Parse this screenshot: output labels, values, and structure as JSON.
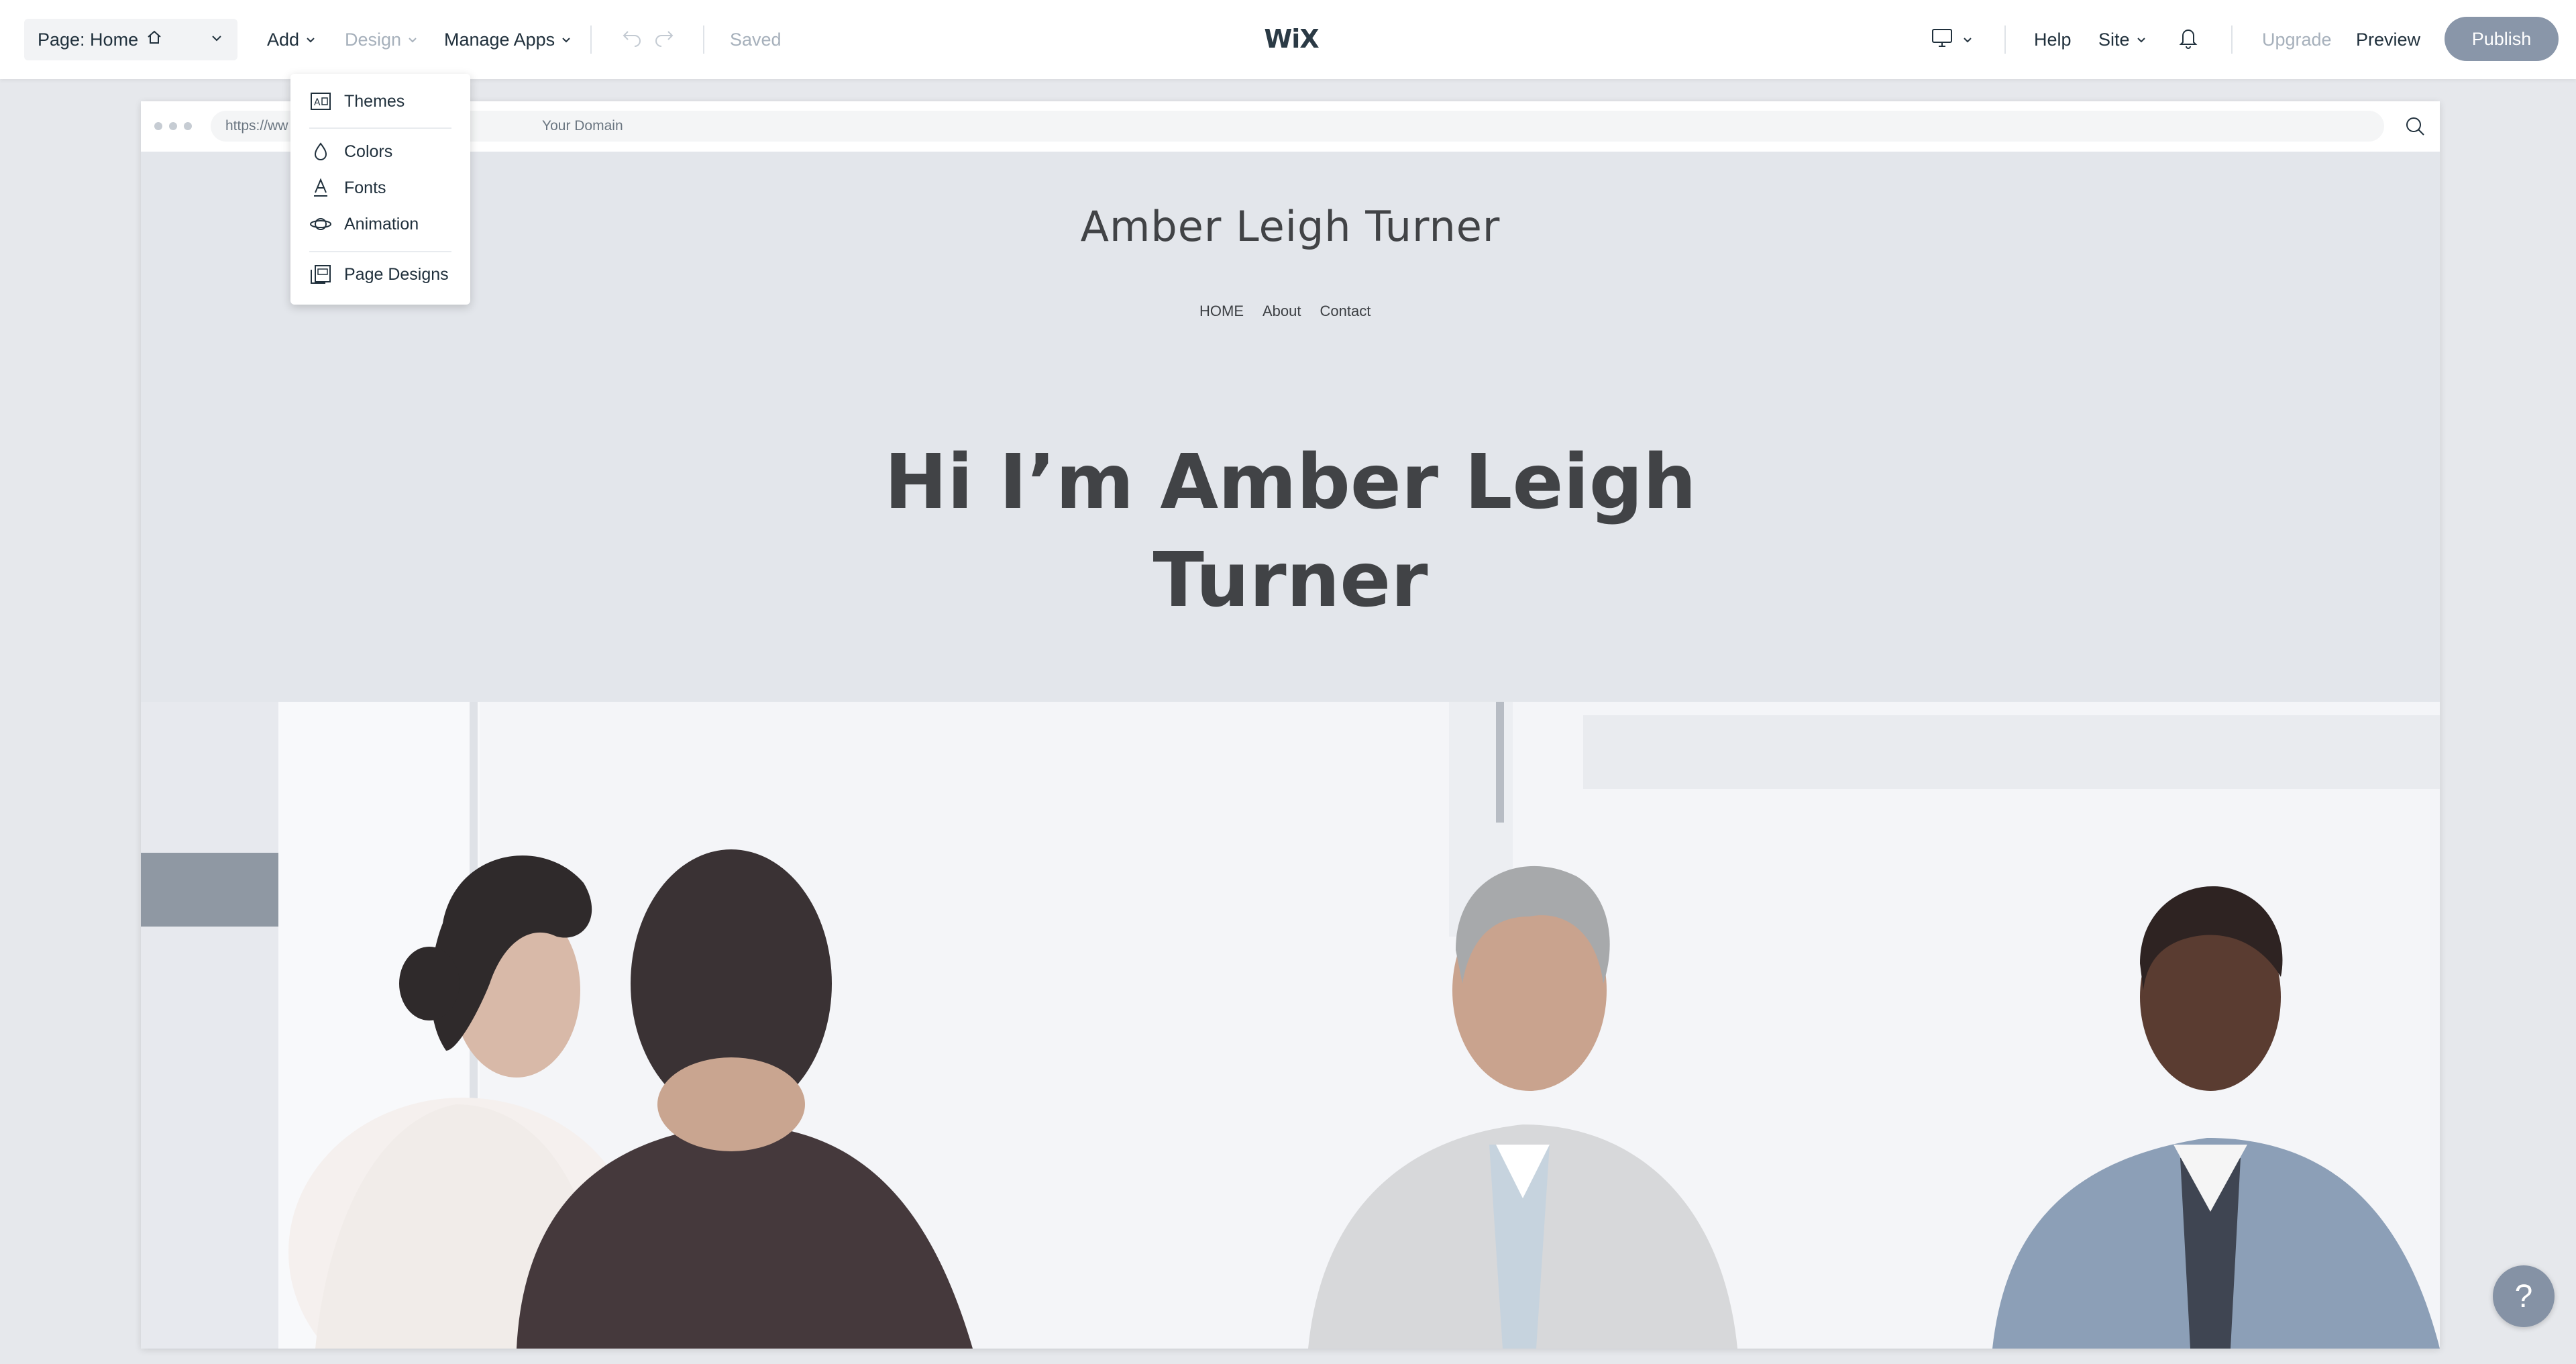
{
  "topbar": {
    "page_select": "Page: Home",
    "menus": {
      "add": "Add",
      "design": "Design",
      "manage_apps": "Manage Apps"
    },
    "status": "Saved",
    "logo": "WiX",
    "right": {
      "help": "Help",
      "site": "Site",
      "upgrade": "Upgrade",
      "preview": "Preview",
      "publish": "Publish"
    },
    "icons": {
      "home": "home-icon",
      "undo": "undo-icon",
      "redo": "redo-icon",
      "device": "desktop-icon",
      "bell": "bell-icon"
    }
  },
  "design_menu": {
    "items": [
      {
        "label": "Themes",
        "icon": "themes-icon"
      },
      {
        "label": "Colors",
        "icon": "drop-icon"
      },
      {
        "label": "Fonts",
        "icon": "font-icon"
      },
      {
        "label": "Animation",
        "icon": "animation-icon"
      },
      {
        "label": "Page Designs",
        "icon": "page-designs-icon"
      }
    ]
  },
  "browser": {
    "url_prefix": "https://ww",
    "url_domain": "Your Domain"
  },
  "site": {
    "title": "Amber Leigh Turner",
    "nav": [
      "HOME",
      "About",
      "Contact"
    ],
    "hero_line1": "Hi I’m Amber Leigh",
    "hero_line2": "Turner"
  },
  "help_button": "?",
  "colors": {
    "publish_bg": "#8996a9",
    "stage_bg": "#e6e8ec",
    "site_bg": "#e3e6eb",
    "heading_text": "#414346"
  }
}
